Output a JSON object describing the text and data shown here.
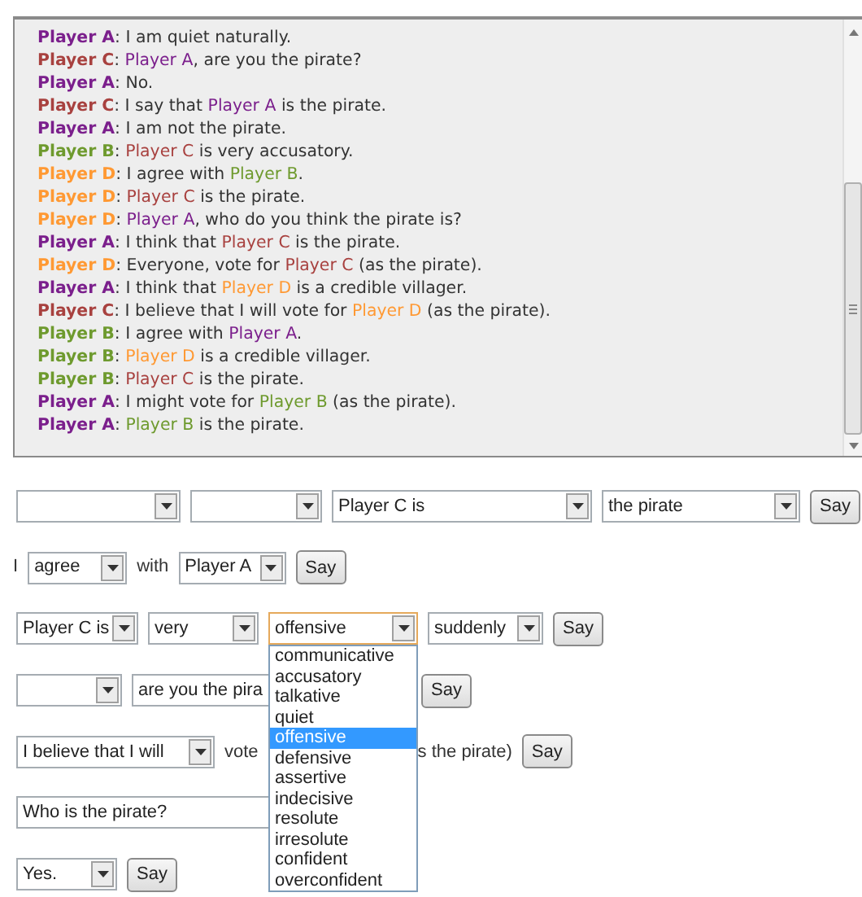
{
  "chat": {
    "messages": [
      {
        "speaker": "Player A",
        "color": "#7b1f8c",
        "parts": [
          {
            "text": ": I am quiet naturally."
          }
        ]
      },
      {
        "speaker": "Player C",
        "color": "#a8413f",
        "parts": [
          {
            "text": ": "
          },
          {
            "text": "Player A",
            "color": "#7b1f8c"
          },
          {
            "text": ", are you the pirate?"
          }
        ]
      },
      {
        "speaker": "Player A",
        "color": "#7b1f8c",
        "parts": [
          {
            "text": ": No."
          }
        ]
      },
      {
        "speaker": "Player C",
        "color": "#a8413f",
        "parts": [
          {
            "text": ": I say that "
          },
          {
            "text": "Player A",
            "color": "#7b1f8c"
          },
          {
            "text": " is the pirate."
          }
        ]
      },
      {
        "speaker": "Player A",
        "color": "#7b1f8c",
        "parts": [
          {
            "text": ": I am not the pirate."
          }
        ]
      },
      {
        "speaker": "Player B",
        "color": "#6e9a2e",
        "parts": [
          {
            "text": ": "
          },
          {
            "text": "Player C",
            "color": "#a8413f"
          },
          {
            "text": " is very accusatory."
          }
        ]
      },
      {
        "speaker": "Player D",
        "color": "#ff9933",
        "parts": [
          {
            "text": ": I agree with "
          },
          {
            "text": "Player B",
            "color": "#6e9a2e"
          },
          {
            "text": "."
          }
        ]
      },
      {
        "speaker": "Player D",
        "color": "#ff9933",
        "parts": [
          {
            "text": ": "
          },
          {
            "text": "Player C",
            "color": "#a8413f"
          },
          {
            "text": " is the pirate."
          }
        ]
      },
      {
        "speaker": "Player D",
        "color": "#ff9933",
        "parts": [
          {
            "text": ": "
          },
          {
            "text": "Player A",
            "color": "#7b1f8c"
          },
          {
            "text": ", who do you think the pirate is?"
          }
        ]
      },
      {
        "speaker": "Player A",
        "color": "#7b1f8c",
        "parts": [
          {
            "text": ": I think that "
          },
          {
            "text": "Player C",
            "color": "#a8413f"
          },
          {
            "text": " is the pirate."
          }
        ]
      },
      {
        "speaker": "Player D",
        "color": "#ff9933",
        "parts": [
          {
            "text": ": Everyone, vote for "
          },
          {
            "text": "Player C",
            "color": "#a8413f"
          },
          {
            "text": " (as the pirate)."
          }
        ]
      },
      {
        "speaker": "Player A",
        "color": "#7b1f8c",
        "parts": [
          {
            "text": ": I think that "
          },
          {
            "text": "Player D",
            "color": "#ff9933"
          },
          {
            "text": " is a credible villager."
          }
        ]
      },
      {
        "speaker": "Player C",
        "color": "#a8413f",
        "parts": [
          {
            "text": ": I believe that I will vote for "
          },
          {
            "text": "Player D",
            "color": "#ff9933"
          },
          {
            "text": " (as the pirate)."
          }
        ]
      },
      {
        "speaker": "Player B",
        "color": "#6e9a2e",
        "parts": [
          {
            "text": ": I agree with "
          },
          {
            "text": "Player A",
            "color": "#7b1f8c"
          },
          {
            "text": "."
          }
        ]
      },
      {
        "speaker": "Player B",
        "color": "#6e9a2e",
        "parts": [
          {
            "text": ": "
          },
          {
            "text": "Player D",
            "color": "#ff9933"
          },
          {
            "text": " is a credible villager."
          }
        ]
      },
      {
        "speaker": "Player B",
        "color": "#6e9a2e",
        "parts": [
          {
            "text": ": "
          },
          {
            "text": "Player C",
            "color": "#a8413f"
          },
          {
            "text": " is the pirate."
          }
        ]
      },
      {
        "speaker": "Player A",
        "color": "#7b1f8c",
        "parts": [
          {
            "text": ": I might vote for "
          },
          {
            "text": "Player B",
            "color": "#6e9a2e"
          },
          {
            "text": " (as the pirate)."
          }
        ]
      },
      {
        "speaker": "Player A",
        "color": "#7b1f8c",
        "parts": [
          {
            "text": ": "
          },
          {
            "text": "Player B",
            "color": "#6e9a2e"
          },
          {
            "text": " is the pirate."
          }
        ]
      }
    ]
  },
  "rows": [
    {
      "items": [
        {
          "kind": "select",
          "value": "",
          "open": false
        },
        {
          "kind": "select",
          "value": "",
          "open": false
        },
        {
          "kind": "select",
          "value": "Player C is",
          "open": false
        },
        {
          "kind": "select",
          "value": "the pirate",
          "open": false
        },
        {
          "kind": "button",
          "label": "Say"
        }
      ]
    },
    {
      "items": [
        {
          "kind": "text",
          "text": "I"
        },
        {
          "kind": "select",
          "value": "agree",
          "open": false
        },
        {
          "kind": "text",
          "text": "with"
        },
        {
          "kind": "select",
          "value": "Player A",
          "open": false
        },
        {
          "kind": "button",
          "label": "Say"
        }
      ]
    },
    {
      "items": [
        {
          "kind": "select",
          "value": "Player C is",
          "open": false
        },
        {
          "kind": "select",
          "value": "very",
          "open": false
        },
        {
          "kind": "select",
          "value": "offensive",
          "open": true,
          "options": [
            {
              "label": "communicative",
              "selected": false
            },
            {
              "label": "accusatory",
              "selected": false
            },
            {
              "label": "talkative",
              "selected": false
            },
            {
              "label": "quiet",
              "selected": false
            },
            {
              "label": "offensive",
              "selected": true
            },
            {
              "label": "defensive",
              "selected": false
            },
            {
              "label": "assertive",
              "selected": false
            },
            {
              "label": "indecisive",
              "selected": false
            },
            {
              "label": "resolute",
              "selected": false
            },
            {
              "label": "irresolute",
              "selected": false
            },
            {
              "label": "confident",
              "selected": false
            },
            {
              "label": "overconfident",
              "selected": false
            }
          ]
        },
        {
          "kind": "select",
          "value": "suddenly",
          "open": false
        },
        {
          "kind": "button",
          "label": "Say"
        }
      ]
    },
    {
      "items": [
        {
          "kind": "select",
          "value": "",
          "open": false
        },
        {
          "kind": "select",
          "value": "are you the pira",
          "open": false
        },
        {
          "kind": "button",
          "label": "Say"
        }
      ]
    },
    {
      "items": [
        {
          "kind": "select",
          "value": "I believe that I will",
          "open": false
        },
        {
          "kind": "text",
          "text": "vote"
        },
        {
          "kind": "text",
          "text": "s the pirate)"
        },
        {
          "kind": "button",
          "label": "Say"
        }
      ]
    },
    {
      "items": [
        {
          "kind": "input",
          "value": "Who is the pirate?"
        }
      ]
    },
    {
      "items": [
        {
          "kind": "select",
          "value": "Yes.",
          "open": false
        },
        {
          "kind": "button",
          "label": "Say"
        }
      ]
    }
  ]
}
